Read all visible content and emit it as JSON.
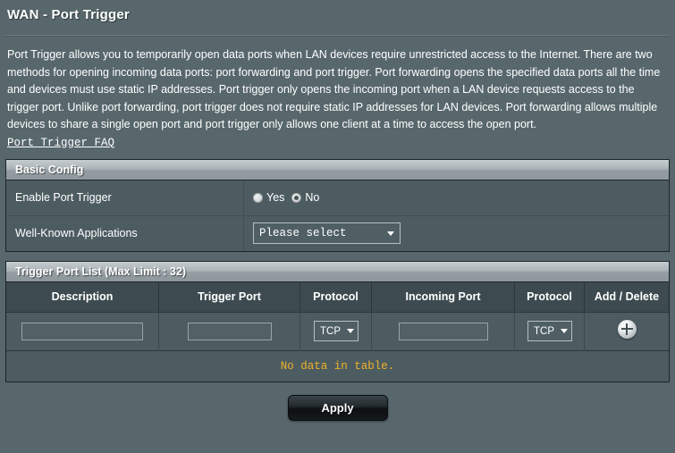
{
  "header": {
    "title": "WAN - Port Trigger"
  },
  "description": {
    "paragraph": "Port Trigger allows you to temporarily open data ports when LAN devices require unrestricted access to the Internet. There are two methods for opening incoming data ports: port forwarding and port trigger. Port forwarding opens the specified data ports all the time and devices must use static IP addresses. Port trigger only opens the incoming port when a LAN device requests access to the trigger port. Unlike port forwarding, port trigger does not require static IP addresses for LAN devices. Port forwarding allows multiple devices to share a single open port and port trigger only allows one client at a time to access the open port.",
    "faq_link": "Port Trigger FAQ"
  },
  "basic_config": {
    "section_title": "Basic Config",
    "enable_port_trigger": {
      "label": "Enable Port Trigger",
      "options": [
        "Yes",
        "No"
      ],
      "selected": "No"
    },
    "well_known_applications": {
      "label": "Well-Known Applications",
      "selected": "Please select"
    }
  },
  "trigger_port_list": {
    "section_title": "Trigger Port List (Max Limit : 32)",
    "columns": [
      "Description",
      "Trigger Port",
      "Protocol",
      "Incoming Port",
      "Protocol",
      "Add / Delete"
    ],
    "entry_row": {
      "description_value": "",
      "description_placeholder": "",
      "trigger_port_value": "",
      "trigger_port_placeholder": "",
      "trigger_protocol_selected": "TCP",
      "incoming_port_value": "",
      "incoming_port_placeholder": "",
      "incoming_protocol_selected": "TCP",
      "add_icon": "plus-circle-icon"
    },
    "empty_message": "No data in table."
  },
  "footer": {
    "apply_label": "Apply"
  },
  "colors": {
    "background": "#57676c",
    "panel_row": "#4d5c61",
    "table_header": "#3d4b50",
    "section_bar": "#aab3b7",
    "empty_message": "#f0b429",
    "border": "#1d2527"
  }
}
